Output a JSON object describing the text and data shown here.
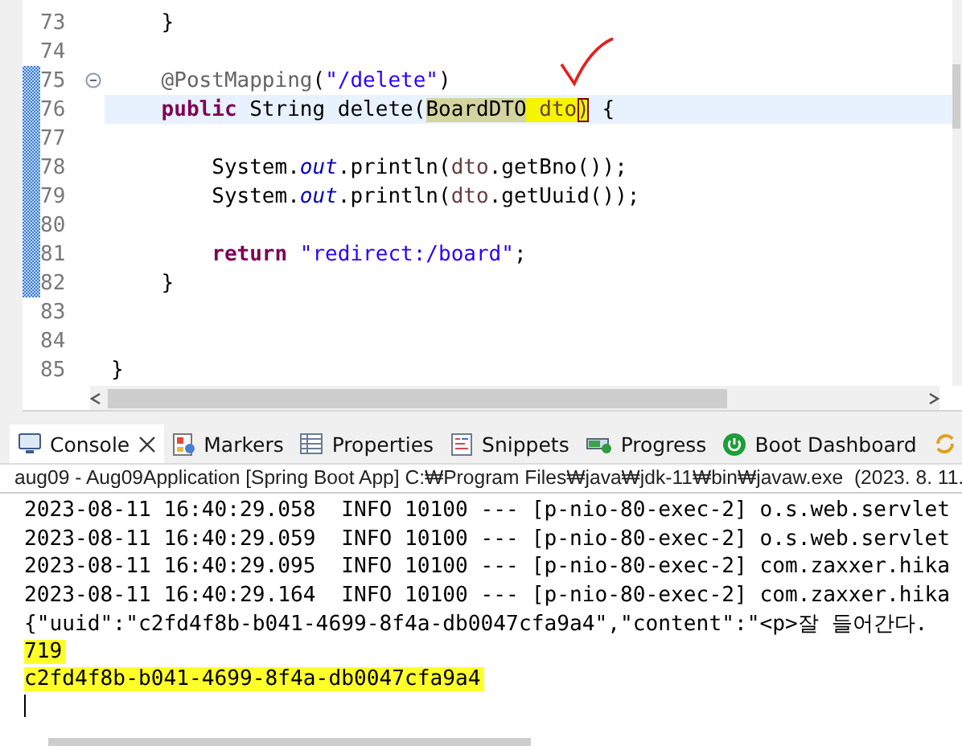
{
  "editor": {
    "lines": [
      {
        "number": "73",
        "current": false,
        "changed": false,
        "fold": false,
        "tokens": [
          {
            "kind": "plain",
            "text": "    }"
          }
        ]
      },
      {
        "number": "74",
        "current": false,
        "changed": false,
        "fold": false
      },
      {
        "number": "75",
        "current": false,
        "changed": true,
        "fold": true,
        "tokens": [
          {
            "kind": "annotation",
            "text": "    @PostMapping"
          },
          {
            "kind": "plain",
            "text": "("
          },
          {
            "kind": "string",
            "text": "\"/delete\""
          },
          {
            "kind": "plain",
            "text": ")"
          }
        ]
      },
      {
        "number": "76",
        "current": true,
        "changed": true,
        "fold": false,
        "tokens": [
          {
            "kind": "keyword",
            "text": "    public"
          },
          {
            "kind": "plain",
            "text": " String delete("
          },
          {
            "kind": "occurrence",
            "text": "BoardDTO"
          },
          {
            "kind": "marked_param",
            "text": " dto"
          },
          {
            "kind": "bracket",
            "text": ")"
          },
          {
            "kind": "plain",
            "text": " {"
          }
        ]
      },
      {
        "number": "77",
        "current": false,
        "changed": true,
        "fold": false
      },
      {
        "number": "78",
        "current": false,
        "changed": true,
        "fold": false,
        "tokens": [
          {
            "kind": "plain",
            "text": "        System."
          },
          {
            "kind": "static_field",
            "text": "out"
          },
          {
            "kind": "plain",
            "text": ".println("
          },
          {
            "kind": "param",
            "text": "dto"
          },
          {
            "kind": "plain",
            "text": ".getBno());"
          }
        ]
      },
      {
        "number": "79",
        "current": false,
        "changed": true,
        "fold": false,
        "tokens": [
          {
            "kind": "plain",
            "text": "        System."
          },
          {
            "kind": "static_field",
            "text": "out"
          },
          {
            "kind": "plain",
            "text": ".println("
          },
          {
            "kind": "param",
            "text": "dto"
          },
          {
            "kind": "plain",
            "text": ".getUuid());"
          }
        ]
      },
      {
        "number": "80",
        "current": false,
        "changed": true,
        "fold": false
      },
      {
        "number": "81",
        "current": false,
        "changed": true,
        "fold": false,
        "tokens": [
          {
            "kind": "keyword",
            "text": "        return"
          },
          {
            "kind": "string",
            "text": " \"redirect:/board\""
          },
          {
            "kind": "plain",
            "text": ";"
          }
        ]
      },
      {
        "number": "82",
        "current": false,
        "changed": true,
        "fold": false,
        "tokens": [
          {
            "kind": "plain",
            "text": "    }"
          }
        ]
      },
      {
        "number": "83",
        "current": false,
        "changed": false,
        "fold": false
      },
      {
        "number": "84",
        "current": false,
        "changed": false,
        "fold": false
      },
      {
        "number": "85",
        "current": false,
        "changed": false,
        "fold": false,
        "tokens": [
          {
            "kind": "plain",
            "text": "}"
          }
        ]
      }
    ]
  },
  "views": {
    "tabs": [
      {
        "label": "Console",
        "selected": true,
        "closable": true
      },
      {
        "label": "Markers",
        "selected": false,
        "closable": false
      },
      {
        "label": "Properties",
        "selected": false,
        "closable": false
      },
      {
        "label": "Snippets",
        "selected": false,
        "closable": false
      },
      {
        "label": "Progress",
        "selected": false,
        "closable": false
      },
      {
        "label": "Boot Dashboard",
        "selected": false,
        "closable": false
      }
    ]
  },
  "console": {
    "title": "aug09 - Aug09Application [Spring Boot App] C:₩Program Files₩java₩jdk-11₩bin₩javaw.exe  (2023. 8. 11.",
    "lines": [
      {
        "text": "2023-08-11 16:40:29.058  INFO 10100 --- [p-nio-80-exec-2] o.s.web.servlet",
        "highlighted": false
      },
      {
        "text": "2023-08-11 16:40:29.059  INFO 10100 --- [p-nio-80-exec-2] o.s.web.servlet",
        "highlighted": false
      },
      {
        "text": "2023-08-11 16:40:29.095  INFO 10100 --- [p-nio-80-exec-2] com.zaxxer.hika",
        "highlighted": false
      },
      {
        "text": "2023-08-11 16:40:29.164  INFO 10100 --- [p-nio-80-exec-2] com.zaxxer.hika",
        "highlighted": false
      },
      {
        "text": "{\"uuid\":\"c2fd4f8b-b041-4699-8f4a-db0047cfa9a4\",\"content\":\"<p>잘 들어간다.",
        "highlighted": false
      },
      {
        "text": "719",
        "highlighted": true
      },
      {
        "text": "c2fd4f8b-b041-4699-8f4a-db0047cfa9a4",
        "highlighted": true
      }
    ]
  }
}
